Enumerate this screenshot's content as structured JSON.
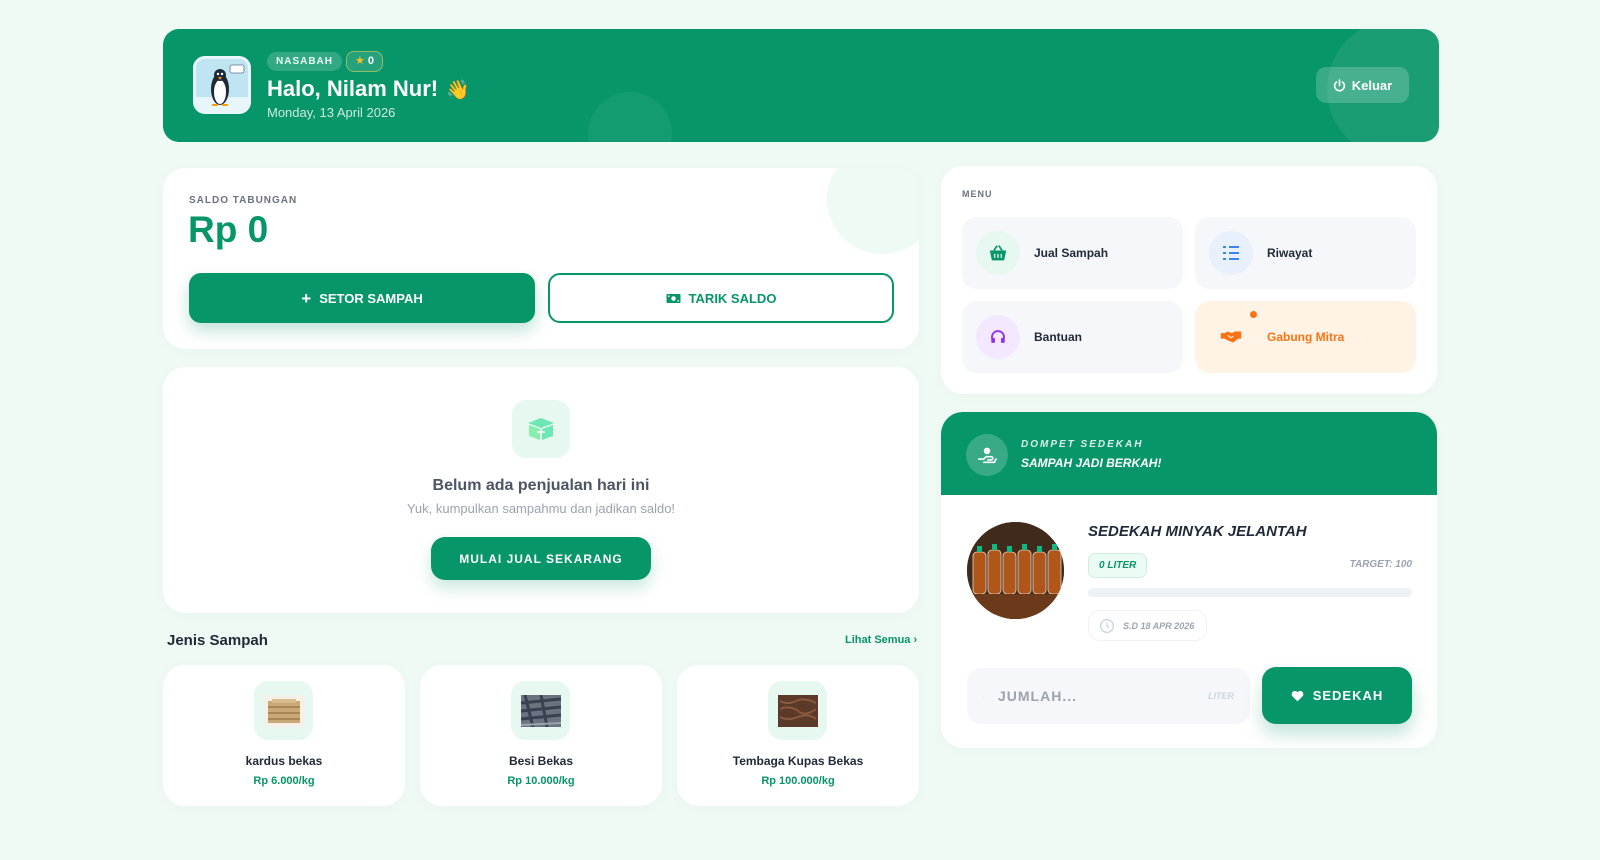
{
  "header": {
    "role_badge": "NASABAH",
    "points": "0",
    "greeting": "Halo, Nilam Nur!",
    "wave_emoji": "👋",
    "date": "Monday, 13 April 2026",
    "logout_label": "Keluar",
    "bg_color": "#07956a"
  },
  "saldo": {
    "label": "SALDO TABUNGAN",
    "amount": "Rp 0",
    "setor_label": "SETOR SAMPAH",
    "tarik_label": "TARIK SALDO"
  },
  "empty_state": {
    "title": "Belum ada penjualan hari ini",
    "subtitle": "Yuk, kumpulkan sampahmu dan jadikan saldo!",
    "cta_label": "MULAI JUAL SEKARANG",
    "icon": "box-icon"
  },
  "jenis_sampah": {
    "title": "Jenis Sampah",
    "see_all": "Lihat Semua",
    "items": [
      {
        "name": "kardus bekas",
        "price": "Rp 6.000/kg"
      },
      {
        "name": "Besi Bekas",
        "price": "Rp 10.000/kg"
      },
      {
        "name": "Tembaga Kupas Bekas",
        "price": "Rp 100.000/kg"
      }
    ]
  },
  "menu": {
    "label": "MENU",
    "items": [
      {
        "label": "Jual Sampah",
        "icon": "basket-icon"
      },
      {
        "label": "Riwayat",
        "icon": "list-icon"
      },
      {
        "label": "Bantuan",
        "icon": "headset-icon"
      },
      {
        "label": "Gabung Mitra",
        "icon": "handshake-icon"
      }
    ]
  },
  "sedekah": {
    "header_title": "DOMPET SEDEKAH",
    "header_subtitle": "SAMPAH JADI BERKAH!",
    "campaign_title": "SEDEKAH MINYAK JELANTAH",
    "collected": "0 LITER",
    "target": "TARGET: 100",
    "progress": 0,
    "deadline": "S.D 18 APR 2026",
    "amount_placeholder": "JUMLAH...",
    "unit": "LITER",
    "button_label": "SEDEKAH"
  }
}
